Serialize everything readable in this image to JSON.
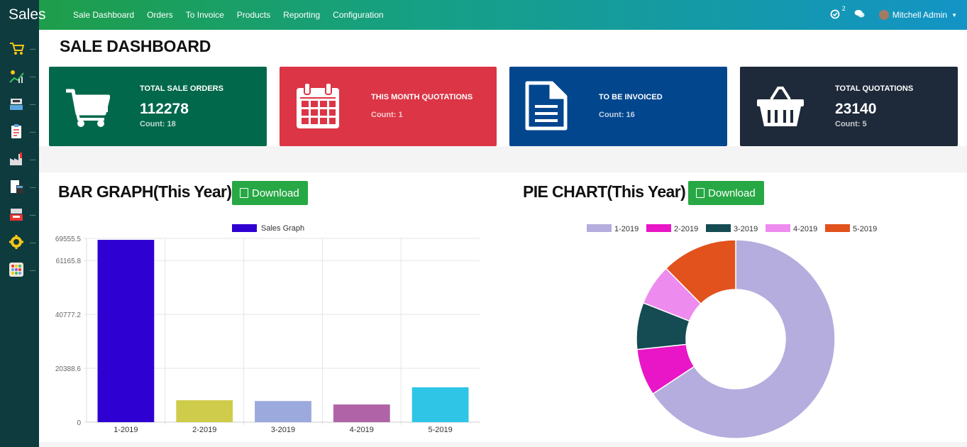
{
  "app": {
    "brand": "Sales"
  },
  "menu": [
    "Sale Dashboard",
    "Orders",
    "To Invoice",
    "Products",
    "Reporting",
    "Configuration"
  ],
  "topbar": {
    "activity_count": "2",
    "user_name": "Mitchell Admin"
  },
  "sidebar": {
    "items": [
      {
        "icon": "cart-icon",
        "label": "..."
      },
      {
        "icon": "chart-icon",
        "label": "..."
      },
      {
        "icon": "register-icon",
        "label": "..."
      },
      {
        "icon": "clipboard-icon",
        "label": "..."
      },
      {
        "icon": "factory-icon",
        "label": "..."
      },
      {
        "icon": "calculator-icon",
        "label": "..."
      },
      {
        "icon": "pos-icon",
        "label": "..."
      },
      {
        "icon": "settings-icon",
        "label": "..."
      },
      {
        "icon": "apps-icon",
        "label": "..."
      }
    ]
  },
  "page": {
    "title": "SALE DASHBOARD"
  },
  "cards": [
    {
      "title": "TOTAL SALE ORDERS",
      "value": "112278",
      "count": "Count: 18",
      "color": "#02684b",
      "icon": "cart-icon"
    },
    {
      "title": "THIS MONTH QUOTATIONS",
      "value": "",
      "count": "Count: 1",
      "color": "#dc3545",
      "icon": "calendar-icon"
    },
    {
      "title": "TO BE INVOICED",
      "value": "",
      "count": "Count: 16",
      "color": "#02468e",
      "icon": "document-icon"
    },
    {
      "title": "TOTAL QUOTATIONS",
      "value": "23140",
      "count": "Count: 5",
      "color": "#1e2a3a",
      "icon": "basket-icon"
    }
  ],
  "bar_section": {
    "title": "BAR GRAPH(This Year)",
    "download": "Download"
  },
  "pie_section": {
    "title": "PIE CHART(This Year)",
    "download": "Download"
  },
  "chart_data": [
    {
      "type": "bar",
      "categories": [
        "1-2019",
        "2-2019",
        "3-2019",
        "4-2019",
        "5-2019"
      ],
      "series": [
        {
          "name": "Sales Graph",
          "values": [
            69000,
            8300,
            8000,
            6700,
            13200
          ]
        }
      ],
      "bar_colors": [
        "#2f00d2",
        "#cfcc4b",
        "#9ca9dc",
        "#b064a7",
        "#2ec5e7"
      ],
      "legend_color": "#2f00d2",
      "y_ticks": [
        "0",
        "20388.6",
        "40777.2",
        "61165.8",
        "69555.5"
      ],
      "ylim": [
        0,
        69555.5
      ],
      "legend_position": "top",
      "grid": true
    },
    {
      "type": "pie",
      "labels": [
        "1-2019",
        "2-2019",
        "3-2019",
        "4-2019",
        "5-2019"
      ],
      "values": [
        69,
        8,
        8,
        7,
        13
      ],
      "colors": [
        "#b5addd",
        "#e816c6",
        "#154b52",
        "#ed8bee",
        "#e1521d"
      ],
      "legend_position": "top",
      "donut": true
    }
  ]
}
